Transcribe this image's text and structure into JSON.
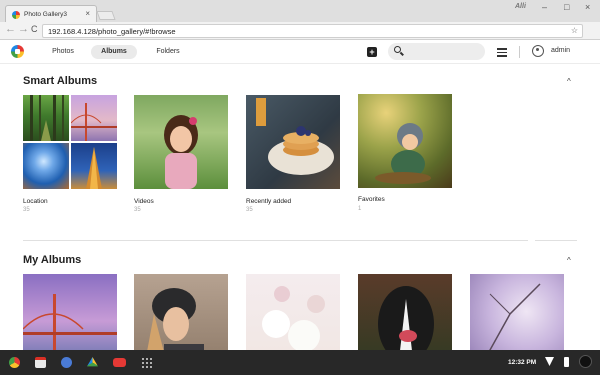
{
  "browser": {
    "tab_title": "Photo Gallery3",
    "tab_close": "×",
    "window_title": "Alli",
    "url": "192.168.4.128/photo_gallery/#!browse",
    "nav_back": "←",
    "nav_forward": "→",
    "nav_reload": "C",
    "bookmark": "☆",
    "minimize": "–",
    "maximize": "□",
    "close": "×"
  },
  "app": {
    "tabs": [
      {
        "label": "Photos",
        "active": false
      },
      {
        "label": "Albums",
        "active": true
      },
      {
        "label": "Folders",
        "active": false
      }
    ],
    "add_label": "+",
    "search_placeholder": "",
    "username": "admin"
  },
  "sections": {
    "smart": {
      "title": "Smart Albums",
      "collapse_glyph": "^",
      "albums": [
        {
          "name": "Location",
          "count": "35"
        },
        {
          "name": "Videos",
          "count": "35"
        },
        {
          "name": "Recently added",
          "count": "35"
        },
        {
          "name": "Favorites",
          "count": "1"
        }
      ]
    },
    "mine": {
      "title": "My Albums",
      "collapse_glyph": "^"
    }
  },
  "taskbar": {
    "time": "12:32 PM",
    "apps": [
      "chrome-icon",
      "gmail-icon",
      "docs-icon",
      "drive-icon",
      "youtube-icon",
      "app-launcher-icon"
    ]
  },
  "colors": {
    "taskbar": "#282828",
    "active_tab": "#eaeaea",
    "accent_red": "#e53935"
  }
}
